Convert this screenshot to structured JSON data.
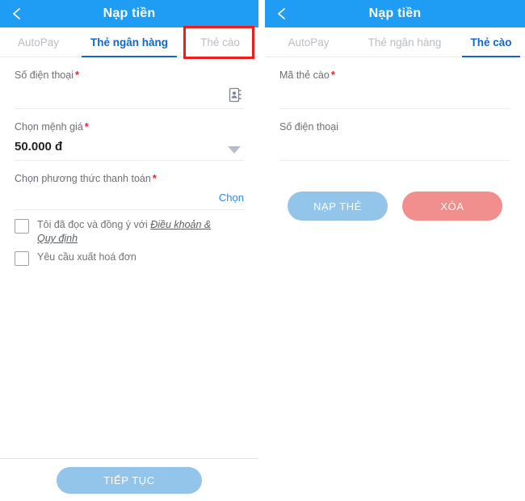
{
  "colors": {
    "header_blue": "#1f9df4",
    "tab_active_blue": "#1266c9",
    "tab_inactive_gray": "#b9bcc0",
    "link_blue": "#2f8ae4",
    "required_red": "#e8262a",
    "annotation_red": "#ee1c1c",
    "button_blue": "#93c5ea",
    "button_red": "#f18e8e"
  },
  "left_screen": {
    "header": {
      "title": "Nạp tiền",
      "back_icon": "chevron-left-icon"
    },
    "tabs": [
      {
        "label": "AutoPay",
        "active": false
      },
      {
        "label": "Thẻ ngân hàng",
        "active": true
      },
      {
        "label": "Thẻ cào",
        "active": false,
        "annotated": true
      }
    ],
    "form": {
      "phone": {
        "label": "Số điện thoại",
        "required": "*",
        "value": "",
        "placeholder": "",
        "icon": "contact-book-icon"
      },
      "denomination": {
        "label": "Chọn mệnh giá",
        "required": "*",
        "value": "50.000 đ",
        "icon": "chevron-down-icon"
      },
      "payment_method": {
        "label": "Chọn phương thức thanh toán",
        "required": "*",
        "choose_label": "Chọn"
      },
      "checkboxes": [
        {
          "text_before": "Tôi đã đọc và đồng ý với ",
          "link_text": "Điều khoản & Quy định",
          "checked": false
        },
        {
          "text_before": "Yêu cầu xuất hoá đơn",
          "link_text": "",
          "checked": false
        }
      ]
    },
    "footer": {
      "continue_label": "TIẾP TỤC"
    }
  },
  "right_screen": {
    "header": {
      "title": "Nạp tiền",
      "back_icon": "chevron-left-icon"
    },
    "tabs": [
      {
        "label": "AutoPay",
        "active": false
      },
      {
        "label": "Thẻ ngân hàng",
        "active": false
      },
      {
        "label": "Thẻ cào",
        "active": true
      }
    ],
    "form": {
      "card_code": {
        "label": "Mã thẻ cào",
        "required": "*",
        "value": "",
        "placeholder": ""
      },
      "phone": {
        "label": "Số điện thoại",
        "required": "",
        "value": "",
        "placeholder": ""
      }
    },
    "actions": {
      "topup_label": "NẠP THẺ",
      "clear_label": "XÓA"
    }
  }
}
